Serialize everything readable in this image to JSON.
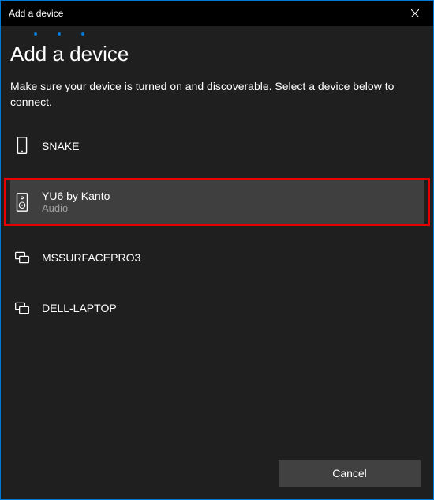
{
  "titlebar": {
    "title": "Add a device"
  },
  "header": {
    "heading": "Add a device",
    "subheading": "Make sure your device is turned on and discoverable. Select a device below to connect."
  },
  "devices": [
    {
      "name": "SNAKE",
      "subtitle": "",
      "icon": "phone",
      "selected": false
    },
    {
      "name": "YU6 by Kanto",
      "subtitle": "Audio",
      "icon": "speaker",
      "selected": true,
      "highlighted": true
    },
    {
      "name": "MSSURFACEPRO3",
      "subtitle": "",
      "icon": "computer",
      "selected": false
    },
    {
      "name": "DELL-LAPTOP",
      "subtitle": "",
      "icon": "computer",
      "selected": false
    }
  ],
  "footer": {
    "cancel_label": "Cancel"
  },
  "colors": {
    "highlight": "#e60000",
    "accent": "#0078d4"
  }
}
